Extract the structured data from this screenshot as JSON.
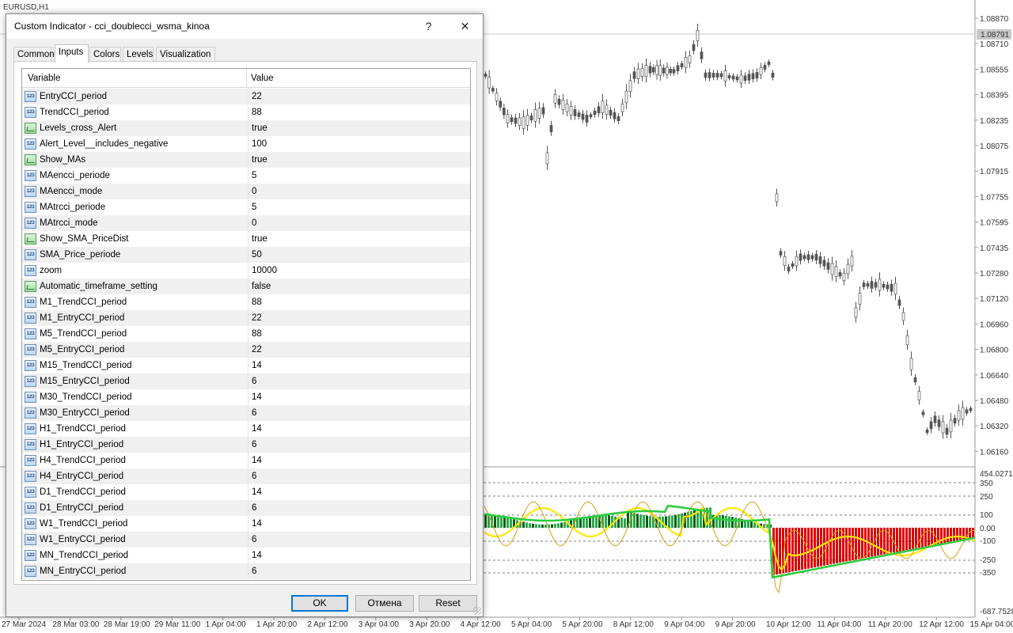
{
  "chart": {
    "symbol": "EURUSD,H1",
    "price_axis": [
      "1.08870",
      "1.08710",
      "1.08555",
      "1.08395",
      "1.08235",
      "1.08075",
      "1.07915",
      "1.07755",
      "1.07595",
      "1.07435",
      "1.07280",
      "1.07120",
      "1.06960",
      "1.06800",
      "1.06640",
      "1.06480",
      "1.06320",
      "1.06160"
    ],
    "current_price": "1.08791",
    "indicator_axis": [
      "454.0271",
      "350",
      "250",
      "100",
      "0.00",
      "-100",
      "-250",
      "-350",
      "-687.7528"
    ],
    "time_axis": [
      "27 Mar 2024",
      "28 Mar 03:00",
      "28 Mar 19:00",
      "29 Mar 11:00",
      "1 Apr 04:00",
      "1 Apr 20:00",
      "2 Apr 12:00",
      "3 Apr 04:00",
      "3 Apr 20:00",
      "4 Apr 12:00",
      "5 Apr 04:00",
      "5 Apr 20:00",
      "8 Apr 12:00",
      "9 Apr 04:00",
      "9 Apr 20:00",
      "10 Apr 12:00",
      "11 Apr 04:00",
      "11 Apr 20:00",
      "12 Apr 12:00",
      "15 Apr 04:00"
    ],
    "colors": {
      "bull": "#2ecc40",
      "bear": "#e00000",
      "yellow": "#ffe600",
      "green_line": "#2ecc40",
      "candle": "#555555"
    }
  },
  "dialog": {
    "title": "Custom Indicator - cci_doublecci_wsma_kinoa",
    "help_label": "?",
    "close_label": "✕",
    "tabs": [
      "Common",
      "Inputs",
      "Colors",
      "Levels",
      "Visualization"
    ],
    "active_tab": "Inputs",
    "columns": {
      "variable": "Variable",
      "value": "Value"
    },
    "rows": [
      {
        "name": "EntryCCI_period",
        "value": "22",
        "type": "int"
      },
      {
        "name": "TrendCCI_period",
        "value": "88",
        "type": "int"
      },
      {
        "name": "Levels_cross_Alert",
        "value": "true",
        "type": "bool"
      },
      {
        "name": "Alert_Level__includes_negative",
        "value": "100",
        "type": "int"
      },
      {
        "name": "Show_MAs",
        "value": "true",
        "type": "bool"
      },
      {
        "name": "MAencci_periode",
        "value": "5",
        "type": "int"
      },
      {
        "name": "MAencci_mode",
        "value": "0",
        "type": "int"
      },
      {
        "name": "MAtrcci_periode",
        "value": "5",
        "type": "int"
      },
      {
        "name": "MAtrcci_mode",
        "value": "0",
        "type": "int"
      },
      {
        "name": "Show_SMA_PriceDist",
        "value": "true",
        "type": "bool"
      },
      {
        "name": "SMA_Price_periode",
        "value": "50",
        "type": "int"
      },
      {
        "name": "zoom",
        "value": "10000",
        "type": "int"
      },
      {
        "name": "Automatic_timeframe_setting",
        "value": "false",
        "type": "bool"
      },
      {
        "name": "M1_TrendCCI_period",
        "value": "88",
        "type": "int"
      },
      {
        "name": "M1_EntryCCI_period",
        "value": "22",
        "type": "int"
      },
      {
        "name": "M5_TrendCCI_period",
        "value": "88",
        "type": "int"
      },
      {
        "name": "M5_EntryCCI_period",
        "value": "22",
        "type": "int"
      },
      {
        "name": "M15_TrendCCI_period",
        "value": "14",
        "type": "int"
      },
      {
        "name": "M15_EntryCCI_period",
        "value": "6",
        "type": "int"
      },
      {
        "name": "M30_TrendCCI_period",
        "value": "14",
        "type": "int"
      },
      {
        "name": "M30_EntryCCI_period",
        "value": "6",
        "type": "int"
      },
      {
        "name": "H1_TrendCCI_period",
        "value": "14",
        "type": "int"
      },
      {
        "name": "H1_EntryCCI_period",
        "value": "6",
        "type": "int"
      },
      {
        "name": "H4_TrendCCI_period",
        "value": "14",
        "type": "int"
      },
      {
        "name": "H4_EntryCCI_period",
        "value": "6",
        "type": "int"
      },
      {
        "name": "D1_TrendCCI_period",
        "value": "14",
        "type": "int"
      },
      {
        "name": "D1_EntryCCI_period",
        "value": "6",
        "type": "int"
      },
      {
        "name": "W1_TrendCCI_period",
        "value": "14",
        "type": "int"
      },
      {
        "name": "W1_EntryCCI_period",
        "value": "6",
        "type": "int"
      },
      {
        "name": "MN_TrendCCI_period",
        "value": "14",
        "type": "int"
      },
      {
        "name": "MN_EntryCCI_period",
        "value": "6",
        "type": "int"
      }
    ],
    "int_icon_text": "123",
    "buttons": {
      "ok": "OK",
      "cancel": "Отмена",
      "reset": "Reset"
    }
  }
}
